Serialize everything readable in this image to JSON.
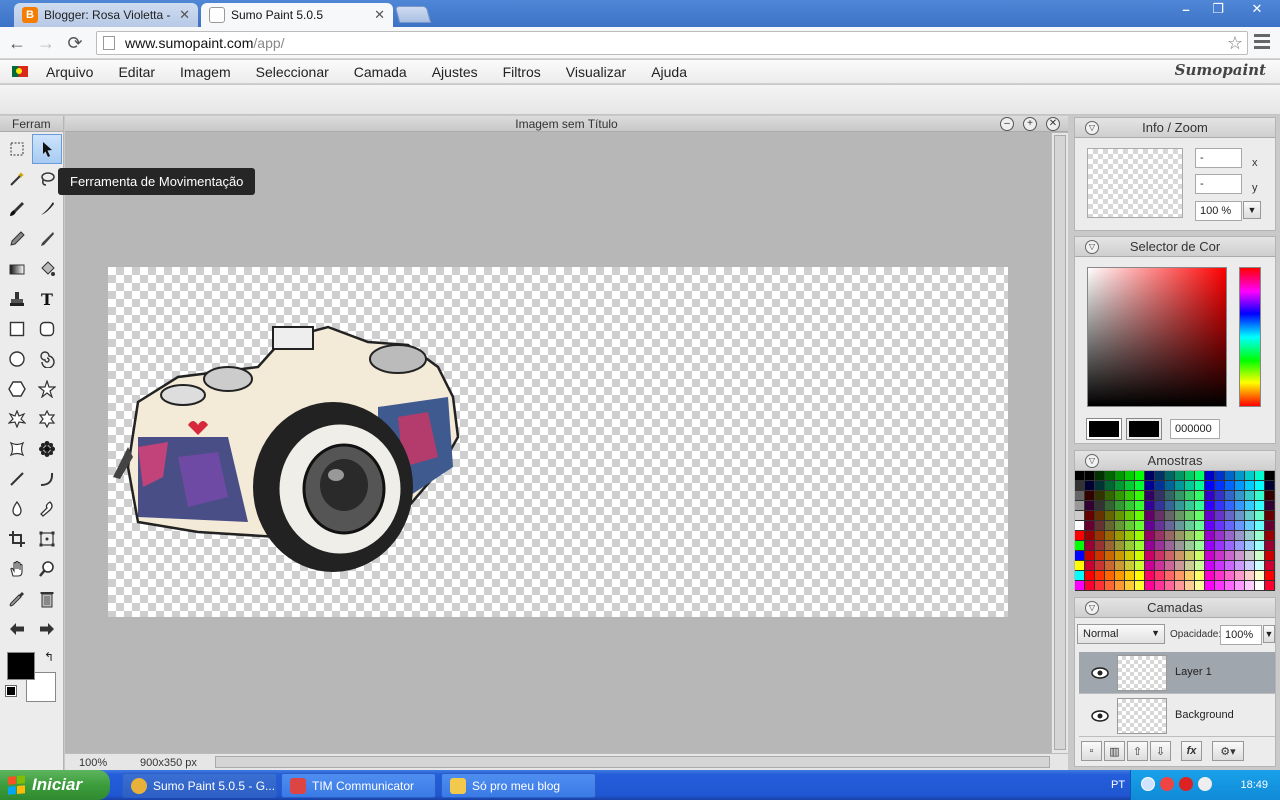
{
  "browser": {
    "tabs": [
      {
        "title": "Blogger: Rosa Violetta - Criar",
        "favicon": "blogger-icon",
        "color": "#f57d00",
        "active": false
      },
      {
        "title": "Sumo Paint 5.0.5",
        "favicon": "page-icon",
        "active": true
      }
    ],
    "url_host": "www.sumopaint.com",
    "url_path": "/app/"
  },
  "app": {
    "brand": "Sumopaint",
    "menu": [
      "Arquivo",
      "Editar",
      "Imagem",
      "Seleccionar",
      "Camada",
      "Ajustes",
      "Filtros",
      "Visualizar",
      "Ajuda"
    ]
  },
  "tools_panel": {
    "title": "Ferram",
    "tooltip": "Ferramenta de Movimentação",
    "tools": [
      "rectangular-marquee-icon",
      "move-arrow-icon",
      "magic-wand-icon",
      "lasso-icon",
      "brush-icon",
      "smudge-brush-icon",
      "pencil-icon",
      "fine-brush-icon",
      "gradient-icon",
      "paint-bucket-icon",
      "clone-stamp-icon",
      "text-icon",
      "rectangle-icon",
      "rounded-rectangle-icon",
      "ellipse-icon",
      "spiral-icon",
      "hexagon-icon",
      "star-icon",
      "star-outline-icon",
      "puzzle-icon",
      "burst-icon",
      "flower-icon",
      "line-icon",
      "curve-icon",
      "blur-drop-icon",
      "smudge-finger-icon",
      "crop-icon",
      "transform-icon",
      "hand-icon",
      "zoom-icon",
      "eyedropper-icon",
      "trash-icon",
      "undo-arrow-icon",
      "redo-arrow-icon"
    ],
    "selected_tool": 1,
    "foreground": "#000000",
    "background": "#ffffff"
  },
  "document": {
    "title": "Imagem sem Título",
    "zoom": "100%",
    "size": "900x350 px"
  },
  "info_panel": {
    "title": "Info / Zoom",
    "x_value": "-",
    "y_value": "-",
    "x_label": "x",
    "y_label": "y",
    "zoom_value": "100 %"
  },
  "color_panel": {
    "title": "Selector de Cor",
    "hex": "000000"
  },
  "swatches_panel": {
    "title": "Amostras"
  },
  "layers_panel": {
    "title": "Camadas",
    "blend_mode": "Normal",
    "opacity_label": "Opacidade:",
    "opacity": "100%",
    "layers": [
      {
        "name": "Layer 1",
        "selected": true
      },
      {
        "name": "Background",
        "selected": false
      }
    ]
  },
  "taskbar": {
    "start_label": "Iniciar",
    "tasks": [
      {
        "title": "Sumo Paint 5.0.5 - G...",
        "color": "#e8b23a"
      },
      {
        "title": "TIM Communicator",
        "color": "#d44"
      },
      {
        "title": "Só pro meu blog",
        "color": "#f2c94c"
      }
    ],
    "lang": "PT",
    "clock": "18:49"
  }
}
